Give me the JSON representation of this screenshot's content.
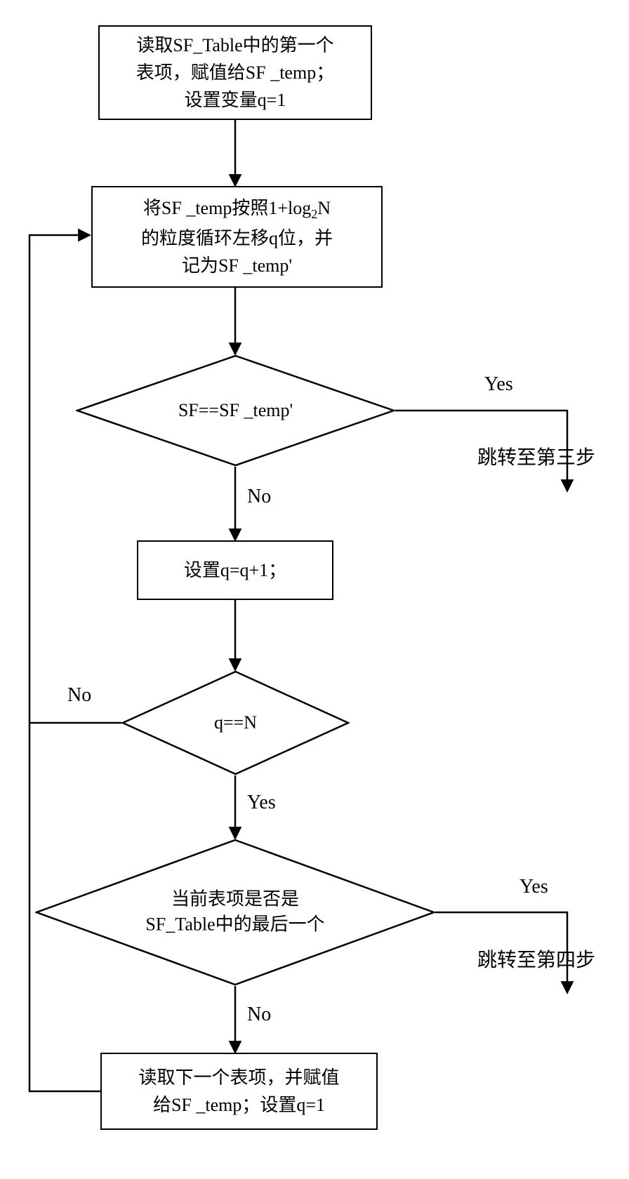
{
  "flow": {
    "n1": {
      "l1": "读取SF_Table中的第一个",
      "l2": "表项，赋值给SF _temp；",
      "l3": "设置变量q=1"
    },
    "n2": {
      "l1": "将SF _temp按照1+log",
      "sub": "2",
      "tail": "N",
      "l2": "的粒度循环左移q位，并",
      "l3": "记为SF _temp'"
    },
    "d1": "SF==SF _temp'",
    "d1_yes": "Yes",
    "d1_yes_target": "跳转至第三步",
    "d1_no": "No",
    "n3": "设置q=q+1；",
    "d2": "q==N",
    "d2_yes": "Yes",
    "d2_no": "No",
    "d3_l1": "当前表项是否是",
    "d3_l2": "SF_Table中的最后一个",
    "d3_yes": "Yes",
    "d3_yes_target": "跳转至第四步",
    "d3_no": "No",
    "n4_l1": "读取下一个表项，并赋值",
    "n4_l2": "给SF _temp；设置q=1"
  }
}
